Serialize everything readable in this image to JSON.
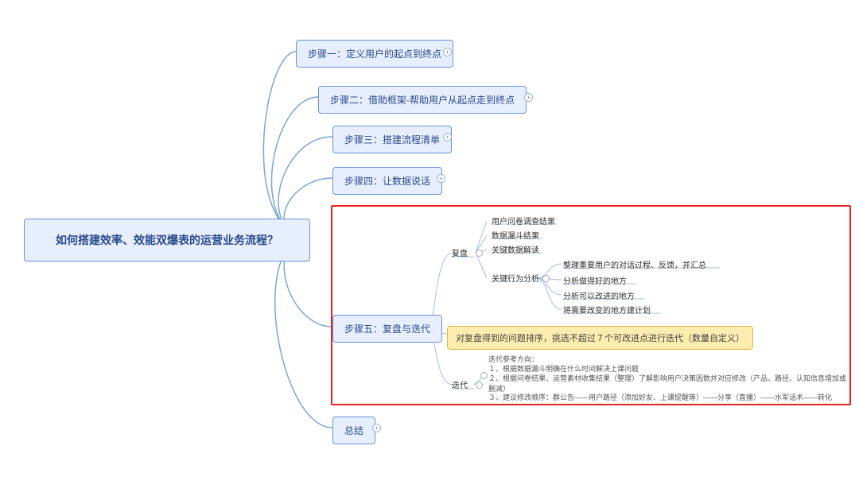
{
  "root": {
    "title": "如何搭建效率、效能双爆表的运营业务流程？"
  },
  "steps": {
    "s1": "步骤一：定义用户的起点到终点",
    "s2": "步骤二：借助框架-帮助用户从起点走到终点",
    "s3": "步骤三：搭建流程清单",
    "s4": "步骤四：让数据说话",
    "s5": "步骤五：复盘与迭代",
    "summary": "总结"
  },
  "detail": {
    "fupan_label": "复盘",
    "diedai_label": "迭代",
    "fupan_items": [
      "用户问卷调查结果",
      "数据漏斗结果",
      "关键数据解读"
    ],
    "keyact_label": "关键行为分析",
    "keyact_items": [
      "整理重要用户的对话过程、反馈，并汇总",
      "分析做得好的地方",
      "分析可以改进的地方",
      "将需要改变的地方建计划"
    ],
    "yellow": "对复盘得到的问题排序，挑选不超过７个可改进点进行迭代（数量自定义）",
    "diedai_title": "迭代参考方向：",
    "diedai_lines": [
      "１、根据数据漏斗明确在什么时间解决上课问题",
      "２、根据问卷结果、运营素材收集结果（整理）了解影响用户决策因数并对应修改（产品、路径、认知信息增加或删减）",
      "３、建议修改顺序：群公告——用户路径（添加好友、上课提醒等）——分享（直播）——水军话术——转化"
    ]
  },
  "icons": {
    "expand": "+",
    "collapse": "−"
  }
}
